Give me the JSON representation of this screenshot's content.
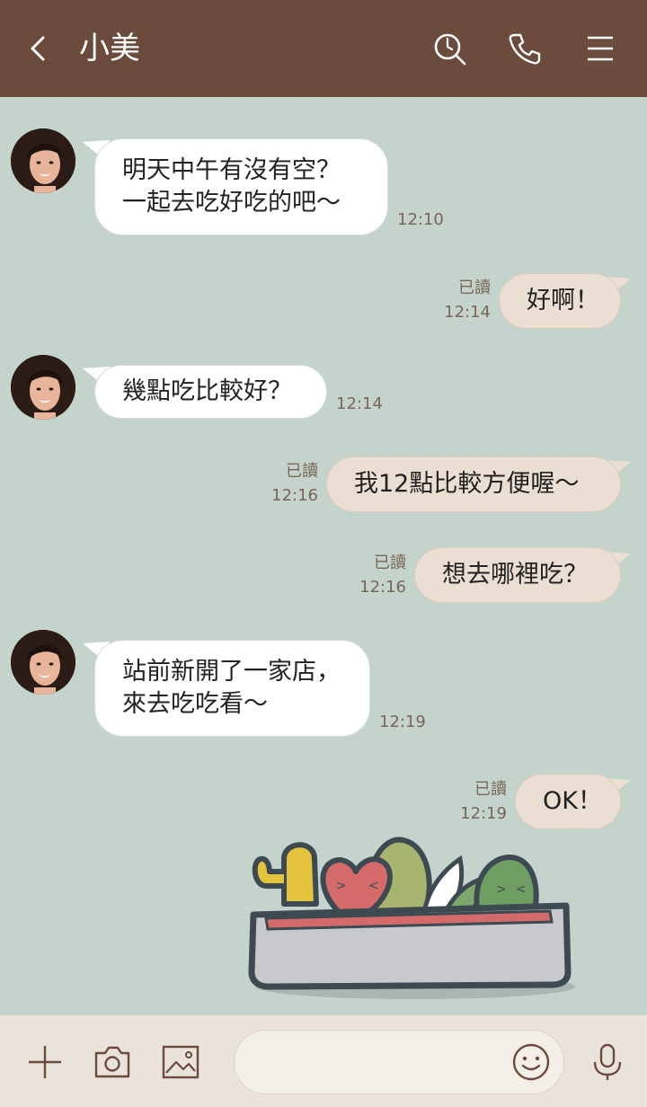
{
  "header": {
    "contact_name": "小美",
    "icons": [
      "back-icon",
      "search-icon",
      "phone-icon",
      "menu-icon"
    ],
    "background": "#6b4b3c"
  },
  "chat": {
    "background": "#c4d4cc",
    "messages": [
      {
        "direction": "incoming",
        "lines": [
          "明天中午有沒有空？",
          "一起去吃好吃的吧～"
        ],
        "time": "12:10"
      },
      {
        "direction": "outgoing",
        "lines": [
          "好啊！"
        ],
        "read": "已讀",
        "time": "12:14"
      },
      {
        "direction": "incoming",
        "lines": [
          "幾點吃比較好？"
        ],
        "time": "12:14"
      },
      {
        "direction": "outgoing",
        "lines": [
          "我12點比較方便喔～"
        ],
        "read": "已讀",
        "time": "12:16"
      },
      {
        "direction": "outgoing",
        "lines": [
          "想去哪裡吃？"
        ],
        "read": "已讀",
        "time": "12:16"
      },
      {
        "direction": "incoming",
        "lines": [
          "站前新開了一家店，",
          "來去吃吃看～"
        ],
        "time": "12:19"
      },
      {
        "direction": "outgoing",
        "lines": [
          "OK！"
        ],
        "read": "已讀",
        "time": "12:19"
      }
    ],
    "sticker": "cactus-planter-sticker"
  },
  "bottom_bar": {
    "icons": [
      "plus-icon",
      "camera-icon",
      "image-icon",
      "emoji-icon",
      "microphone-icon"
    ],
    "input_value": "",
    "background": "#eae3db"
  }
}
